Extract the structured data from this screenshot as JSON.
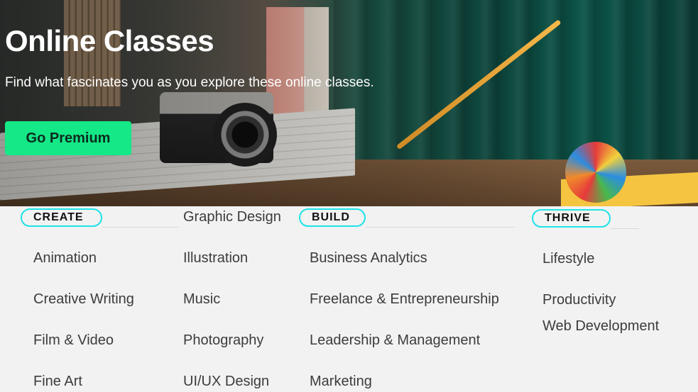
{
  "hero": {
    "title": "Online Classes",
    "subtitle": "Find what fascinates you as you explore these online classes.",
    "cta_label": "Go Premium"
  },
  "colors": {
    "cta": "#15e886",
    "header_outline": "#1ee3e8",
    "background": "#f2f2f2"
  },
  "categories": {
    "create": {
      "header": "CREATE",
      "col1": [
        "Animation",
        "Creative Writing",
        "Film & Video",
        "Fine Art"
      ],
      "col2": [
        "Graphic Design",
        "Illustration",
        "Music",
        "Photography",
        "UI/UX Design"
      ]
    },
    "build": {
      "header": "BUILD",
      "items": [
        "Business Analytics",
        "Freelance & Entrepreneurship",
        "Leadership & Management",
        "Marketing"
      ]
    },
    "thrive": {
      "header": "THRIVE",
      "items": [
        "Lifestyle",
        "Productivity",
        "Web Development"
      ]
    }
  }
}
